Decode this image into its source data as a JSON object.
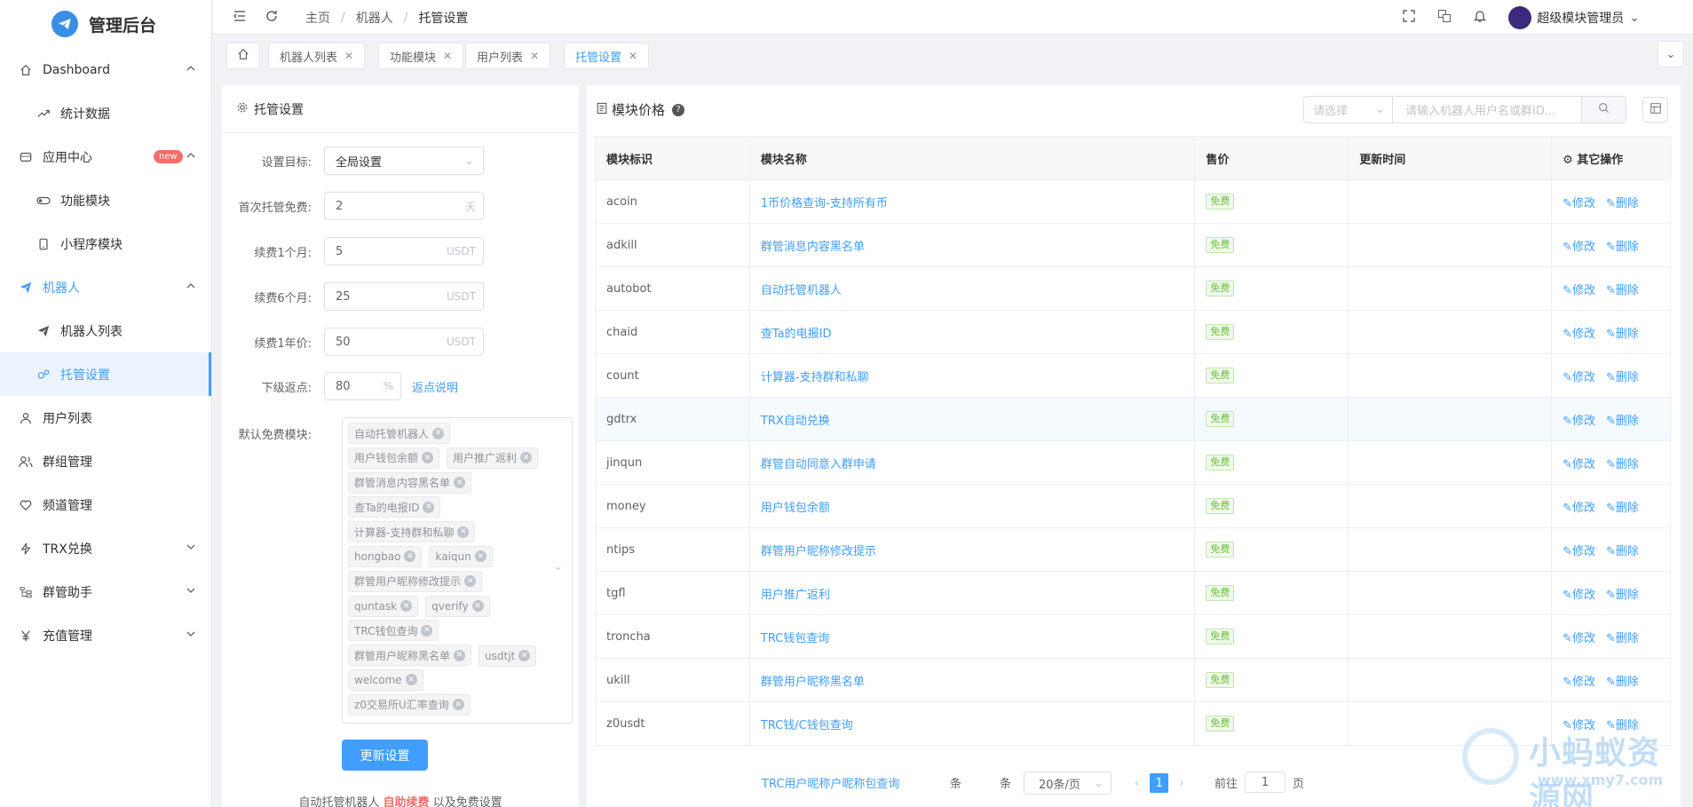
{
  "app": {
    "title": "管理后台"
  },
  "sidebar": {
    "items": [
      {
        "label": "Dashboard",
        "icon": "home-icon",
        "level": 0,
        "arrow": "up"
      },
      {
        "label": "统计数据",
        "icon": "trend-icon",
        "level": 1
      },
      {
        "label": "应用中心",
        "icon": "app-icon",
        "level": 0,
        "badge": "new",
        "arrow": "up"
      },
      {
        "label": "功能模块",
        "icon": "toggle-icon",
        "level": 1
      },
      {
        "label": "小程序模块",
        "icon": "phone-icon",
        "level": 1
      },
      {
        "label": "机器人",
        "icon": "paper-plane-icon",
        "level": 0,
        "arrow": "up",
        "active_parent": true
      },
      {
        "label": "机器人列表",
        "icon": "paper-plane-icon",
        "level": 1
      },
      {
        "label": "托管设置",
        "icon": "gears-icon",
        "level": 1,
        "active": true
      },
      {
        "label": "用户列表",
        "icon": "user-icon",
        "level": 0
      },
      {
        "label": "群组管理",
        "icon": "users-icon",
        "level": 0
      },
      {
        "label": "频道管理",
        "icon": "heart-icon",
        "level": 0
      },
      {
        "label": "TRX兑换",
        "icon": "bolt-icon",
        "level": 0,
        "arrow": "down"
      },
      {
        "label": "群管助手",
        "icon": "tree-icon",
        "level": 0,
        "arrow": "down"
      },
      {
        "label": "充值管理",
        "icon": "yen-icon",
        "level": 0,
        "arrow": "down"
      }
    ]
  },
  "topbar": {
    "breadcrumb": [
      "主页",
      "机器人",
      "托管设置"
    ],
    "user_name": "超级模块管理员"
  },
  "tags": [
    {
      "label": "机器人列表"
    },
    {
      "label": "功能模块"
    },
    {
      "label": "用户列表"
    },
    {
      "label": "托管设置",
      "active": true
    }
  ],
  "settings": {
    "header": "托管设置",
    "target_label": "设置目标:",
    "target_value": "全局设置",
    "first_free_label": "首次托管免费:",
    "first_free_value": "2",
    "first_free_unit": "天",
    "renew1m_label": "续费1个月:",
    "renew1m_value": "5",
    "renew6m_label": "续费6个月:",
    "renew6m_value": "25",
    "renew1y_label": "续费1年价:",
    "renew1y_value": "50",
    "usdt_unit": "USDT",
    "rebate_label": "下级返点:",
    "rebate_value": "80",
    "rebate_unit": "%",
    "rebate_link": "返点说明",
    "free_modules_label": "默认免费模块:",
    "free_modules": [
      "自动托管机器人",
      "用户钱包余额",
      "用户推广返利",
      "群管消息内容黑名单",
      "查Ta的电报ID",
      "计算器-支持群和私聊",
      "hongbao",
      "kaiqun",
      "群管用户昵称修改提示",
      "quntask",
      "qverify",
      "TRC钱包查询",
      "群管用户昵称黑名单",
      "usdtjt",
      "welcome",
      "z0交易所U汇率查询"
    ],
    "submit_label": "更新设置",
    "footer_prefix": "自动托管机器人",
    "footer_highlight": "自助续费",
    "footer_suffix": "以及免费设置"
  },
  "modules": {
    "header": "模块价格",
    "filter_placeholder": "请选择",
    "search_placeholder": "请输入机器人用户名或群ID...",
    "columns": [
      "模块标识",
      "模块名称",
      "售价",
      "更新时间",
      "其它操作"
    ],
    "edit_label": "修改",
    "delete_label": "删除",
    "rows": [
      {
        "id": "acoin",
        "name": "1币价格查询-支持所有币",
        "price": "免费",
        "time": ""
      },
      {
        "id": "adkill",
        "name": "群管消息内容黑名单",
        "price": "免费",
        "time": ""
      },
      {
        "id": "autobot",
        "name": "自动托管机器人",
        "price": "免费",
        "time": ""
      },
      {
        "id": "chaid",
        "name": "查Ta的电报ID",
        "price": "免费",
        "time": ""
      },
      {
        "id": "count",
        "name": "计算器-支持群和私聊",
        "price": "免费",
        "time": ""
      },
      {
        "id": "gdtrx",
        "name": "TRX自动兑换",
        "price": "免费",
        "time": ""
      },
      {
        "id": "jinqun",
        "name": "群管自动同意入群申请",
        "price": "免费",
        "time": ""
      },
      {
        "id": "money",
        "name": "用户钱包余额",
        "price": "免费",
        "time": ""
      },
      {
        "id": "ntips",
        "name": "群管用户昵称修改提示",
        "price": "免费",
        "time": ""
      },
      {
        "id": "tgfl",
        "name": "用户推广返利",
        "price": "免费",
        "time": ""
      },
      {
        "id": "troncha",
        "name": "TRC钱包查询",
        "price": "免费",
        "time": ""
      },
      {
        "id": "ukill",
        "name": "群管用户昵称黑名单",
        "price": "免费",
        "time": ""
      },
      {
        "id": "z0usdt",
        "name": "TRC钱/C钱包查询",
        "price": "免费",
        "time": ""
      }
    ],
    "ghost_row": "TRC用户昵称户昵称包查询",
    "pager": {
      "total_suffix": "条",
      "size": "20条/页",
      "page": "1",
      "goto_label": "前往",
      "goto_value": "1",
      "page_suffix": "页"
    }
  },
  "watermark": {
    "text": "小蚂蚁资源网",
    "url": "www.xmy7.com"
  }
}
